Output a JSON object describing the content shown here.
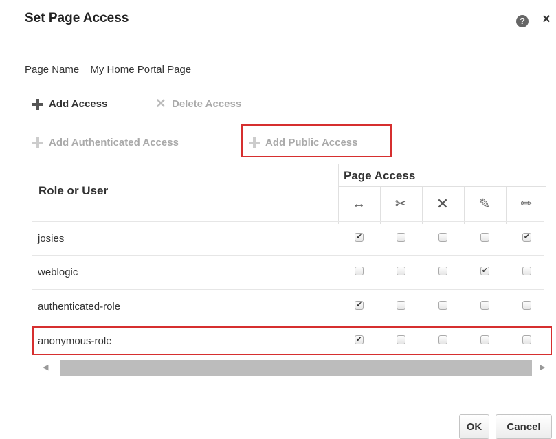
{
  "dialog": {
    "title": "Set Page Access",
    "help_icon": "?",
    "close_icon": "×"
  },
  "page_name": {
    "label": "Page Name",
    "value": "My Home Portal Page"
  },
  "toolbar": {
    "add_access": "Add Access",
    "delete_access": "Delete Access",
    "add_authenticated_access": "Add Authenticated Access",
    "add_public_access": "Add Public Access"
  },
  "table": {
    "role_header": "Role or User",
    "access_header": "Page Access",
    "permission_icons": [
      "view-icon",
      "customize-icon",
      "delete-icon",
      "update-icon",
      "edit-icon"
    ],
    "rows": [
      {
        "name": "josies",
        "perms": [
          true,
          false,
          false,
          false,
          true
        ]
      },
      {
        "name": "weblogic",
        "perms": [
          false,
          false,
          false,
          true,
          false
        ]
      },
      {
        "name": "authenticated-role",
        "perms": [
          true,
          false,
          false,
          false,
          false
        ]
      },
      {
        "name": "anonymous-role",
        "perms": [
          true,
          false,
          false,
          false,
          false
        ]
      }
    ]
  },
  "buttons": {
    "ok": "OK",
    "cancel": "Cancel"
  },
  "colors": {
    "highlight": "#d62f2f"
  }
}
